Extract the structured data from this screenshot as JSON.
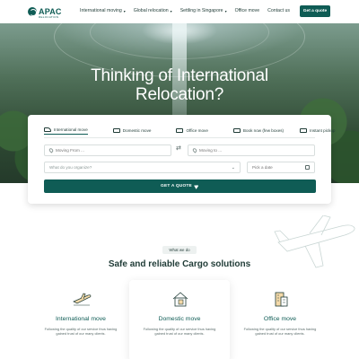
{
  "brand": {
    "name": "APAC",
    "tagline": "RELOCATION"
  },
  "nav": {
    "items": [
      {
        "label": "International moving",
        "has_dropdown": true
      },
      {
        "label": "Global relocation",
        "has_dropdown": true
      },
      {
        "label": "Settling in Singapore",
        "has_dropdown": true
      },
      {
        "label": "Office move",
        "has_dropdown": false
      },
      {
        "label": "Contact us",
        "has_dropdown": false
      }
    ],
    "cta_label": "Get a quote"
  },
  "hero": {
    "title_line1": "Thinking of International",
    "title_line2": "Relocation?"
  },
  "booking": {
    "tabs": [
      {
        "label": "International move",
        "active": true,
        "icon": "plane-icon"
      },
      {
        "label": "Domestic move",
        "active": false,
        "icon": "truck-icon"
      },
      {
        "label": "Office move",
        "active": false,
        "icon": "office-icon"
      },
      {
        "label": "Book now (few boxes)",
        "active": false,
        "icon": "box-icon"
      },
      {
        "label": "Instant pickup",
        "active": false,
        "icon": "van-icon"
      }
    ],
    "moving_from_placeholder": "Moving From ...",
    "moving_to_placeholder": "Moving to ...",
    "what_placeholder": "What do you organize?",
    "date_placeholder": "Pick a date",
    "submit_label": "GET A QUOTE"
  },
  "services": {
    "badge": "What we do",
    "title": "Safe and reliable Cargo solutions",
    "items": [
      {
        "title": "International move",
        "desc": "Following the quality of our service thus having gained trust of our many clients.",
        "icon": "airplane-icon"
      },
      {
        "title": "Domestic move",
        "desc": "Following the quality of our service thus having gained trust of our many clients.",
        "icon": "house-icon"
      },
      {
        "title": "Office move",
        "desc": "Following the quality of our service thus having gained trust of our many clients.",
        "icon": "office-building-icon"
      }
    ]
  },
  "colors": {
    "primary": "#0f5c55",
    "text": "#1f3b36"
  }
}
